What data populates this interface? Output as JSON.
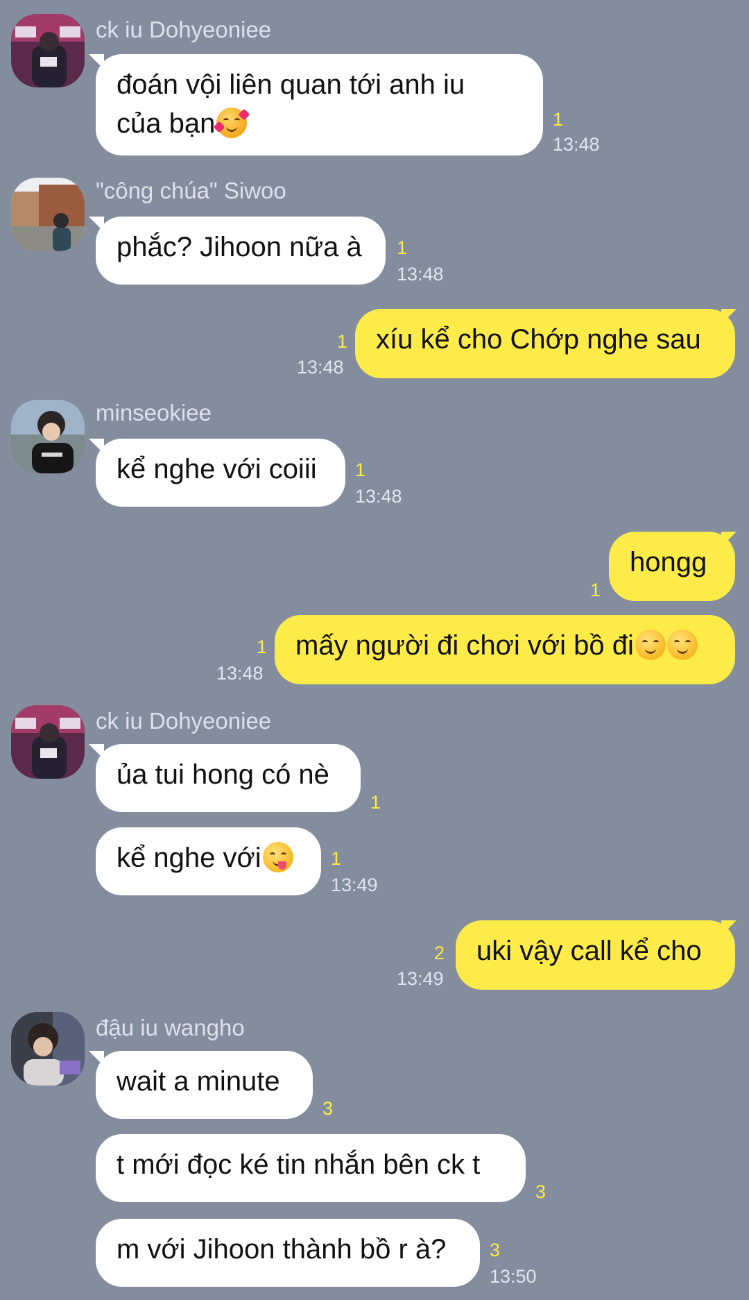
{
  "colors": {
    "background": "#838d9e",
    "incoming_bubble": "#ffffff",
    "outgoing_bubble": "#fdeb4a",
    "unread_count": "#fdeb4a",
    "timestamp": "#e1e5ec",
    "sender_name": "#dde2ea"
  },
  "messages": [
    {
      "sender": "ck iu Dohyeoniee",
      "line1": "đoán vội liên quan tới anh iu",
      "line2": "của bạn",
      "emoji": "smiling-face-with-hearts-emoji",
      "unread": "1",
      "time": "13:48"
    },
    {
      "sender": "\"công chúa\" Siwoo",
      "text": "phắc? Jihoon nữa à",
      "unread": "1",
      "time": "13:48"
    },
    {
      "text": "xíu kể cho Chớp nghe sau",
      "unread": "1",
      "time": "13:48"
    },
    {
      "sender": "minseokiee",
      "text": "kể nghe với coiii",
      "unread": "1",
      "time": "13:48"
    },
    {
      "text": "hongg",
      "unread": "1"
    },
    {
      "text": "mấy người đi chơi với bồ đi",
      "emoji": "smirking-face-emoji",
      "unread": "1",
      "time": "13:48"
    },
    {
      "sender": "ck iu Dohyeoniee",
      "text": "ủa tui hong có nè",
      "unread": "1"
    },
    {
      "text": "kể nghe với",
      "emoji": "face-savoring-food-emoji",
      "unread": "1",
      "time": "13:49"
    },
    {
      "text": "uki vậy call kể cho",
      "unread": "2",
      "time": "13:49"
    },
    {
      "sender": "đậu iu wangho",
      "text": "wait a minute",
      "unread": "3"
    },
    {
      "text": "t mới đọc ké tin nhắn bên ck t",
      "unread": "3"
    },
    {
      "text": "m với Jihoon thành bồ r à?",
      "unread": "3",
      "time": "13:50"
    }
  ]
}
